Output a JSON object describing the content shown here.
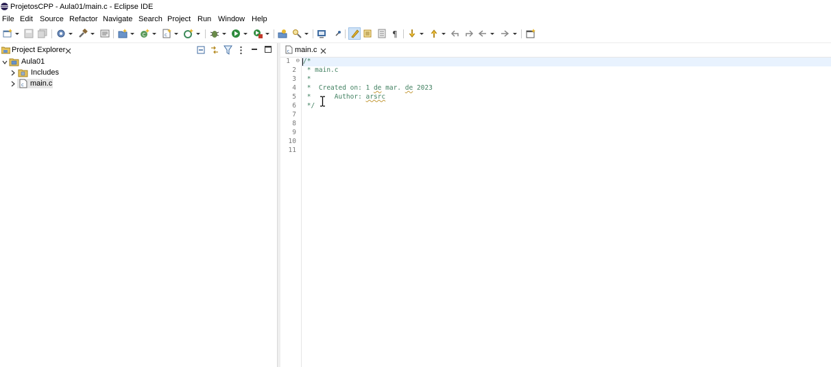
{
  "window": {
    "title": "ProjetosCPP - Aula01/main.c - Eclipse IDE"
  },
  "menu": [
    "File",
    "Edit",
    "Source",
    "Refactor",
    "Navigate",
    "Search",
    "Project",
    "Run",
    "Window",
    "Help"
  ],
  "toolbar": {
    "icons": [
      "new-icon",
      "save-icon",
      "save-all-icon",
      "build-config-icon",
      "build-icon",
      "tasks-icon",
      "new-project-icon",
      "new-class-icon",
      "new-file-icon",
      "new-source-folder-icon",
      "debug-icon",
      "run-icon",
      "coverage-icon",
      "open-type-icon",
      "search-icon",
      "console-icon",
      "pin-icon",
      "mark-occurrences-icon",
      "block-selection-icon",
      "show-whitespace-icon",
      "pilcrow-icon",
      "next-annotation-icon",
      "prev-annotation-icon",
      "last-edit-icon",
      "back-icon",
      "forward-icon",
      "open-perspective-icon"
    ],
    "pressed": "mark-occurrences-icon"
  },
  "project_explorer": {
    "title": "Project Explorer",
    "tree": [
      {
        "label": "Aula01",
        "expanded": true,
        "icon": "project-folder-icon"
      },
      {
        "label": "Includes",
        "expanded": false,
        "icon": "includes-icon"
      },
      {
        "label": "main.c",
        "expanded": false,
        "icon": "c-file-icon",
        "selected": true
      }
    ]
  },
  "editor": {
    "tab_title": "main.c",
    "line_numbers": [
      "1",
      "2",
      "3",
      "4",
      "5",
      "6",
      "7",
      "8",
      "9",
      "10",
      "11"
    ],
    "first_line_fold": "⊖",
    "lines": [
      {
        "pre": "/*",
        "words": []
      },
      {
        "pre": " * main.c",
        "words": []
      },
      {
        "pre": " *",
        "words": []
      },
      {
        "pre": " *  Created on: 1 ",
        "words": [
          {
            "text": "de",
            "squiggle": true
          },
          {
            "text": " mar. ",
            "squiggle": false
          },
          {
            "text": "de",
            "squiggle": true
          },
          {
            "text": " 2023",
            "squiggle": false
          }
        ]
      },
      {
        "pre": " *      Author: ",
        "words": [
          {
            "text": "arsrc",
            "squiggle": true
          }
        ]
      },
      {
        "pre": " */",
        "words": []
      },
      {
        "pre": "",
        "words": []
      },
      {
        "pre": "",
        "words": []
      },
      {
        "pre": "",
        "words": []
      },
      {
        "pre": "",
        "words": []
      },
      {
        "pre": "",
        "words": []
      }
    ]
  },
  "colors": {
    "comment": "#3f7f5f",
    "current_line": "#e8f2fe",
    "selection": "#e5e5e5"
  }
}
